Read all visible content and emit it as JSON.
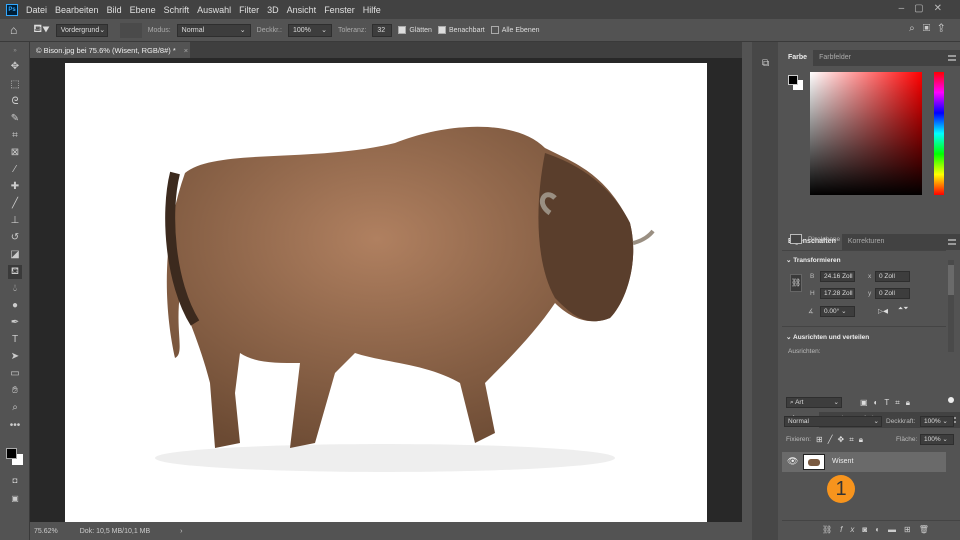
{
  "menubar": {
    "logo": "Ps",
    "items": [
      "Datei",
      "Bearbeiten",
      "Bild",
      "Ebene",
      "Schrift",
      "Auswahl",
      "Filter",
      "3D",
      "Ansicht",
      "Fenster",
      "Hilfe"
    ]
  },
  "options": {
    "fill_source": "Vordergrund",
    "mode_label": "Modus:",
    "mode": "Normal",
    "opacity_label": "Deckkr.:",
    "opacity": "100%",
    "tolerance_label": "Toleranz:",
    "tolerance": "32",
    "smooth": "Glätten",
    "contiguous": "Benachbart",
    "all_layers": "Alle Ebenen",
    "smooth_checked": true,
    "contiguous_checked": true,
    "all_layers_checked": false
  },
  "document": {
    "tab_title": "© Bison.jpg bei 75.6% (Wisent, RGB/8#) *",
    "close": "×"
  },
  "status": {
    "zoom": "75.62%",
    "doc": "Dok: 10,5 MB/10,1 MB",
    "arrow": "›"
  },
  "color_panel": {
    "tabs": [
      "Farbe",
      "Farbfelder"
    ]
  },
  "properties": {
    "tabs": [
      "Eigenschaften",
      "Korrekturen"
    ],
    "type": "Pixelebene",
    "transform_title": "Transformieren",
    "w_label": "B",
    "w": "24.16 Zoll",
    "h_label": "H",
    "h": "17.28 Zoll",
    "x_label": "x",
    "x": "0 Zoll",
    "y_label": "y",
    "y": "0 Zoll",
    "angle": "0.00°",
    "align_title": "Ausrichten und verteilen",
    "align_label": "Ausrichten:"
  },
  "layers": {
    "tabs": [
      "Ebenen",
      "Kanäle",
      "Pfade"
    ],
    "filter": "Art",
    "blend": "Normal",
    "opacity_label": "Deckkraft:",
    "opacity": "100%",
    "lock_label": "Fixieren:",
    "fill_label": "Fläche:",
    "fill": "100%",
    "layer_name": "Wisent",
    "badge": "1"
  },
  "colors": {
    "accent": "#f7941d",
    "foreground": "#000000",
    "background": "#ffffff"
  }
}
